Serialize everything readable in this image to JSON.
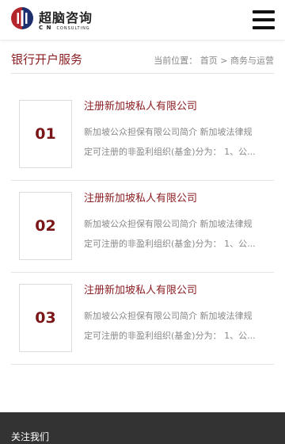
{
  "header": {
    "brand_cn": "超脑咨询",
    "brand_letters": "C N",
    "brand_en": "CONSULTING",
    "colors": {
      "red": "#b3262c",
      "navy": "#1d2f6f"
    }
  },
  "page": {
    "title": "银行开户服务",
    "breadcrumb_label": "当前位置：",
    "breadcrumb_home": "首页",
    "breadcrumb_sep": ">",
    "breadcrumb_current": "商务与运营"
  },
  "items": [
    {
      "number": "01",
      "title": "注册新加坡私人有限公司",
      "desc_line1": "新加坡公众担保有限公司简介 新加坡法律规",
      "desc_line2": "定可注册的非盈利组织(基金)分为：  1、公..."
    },
    {
      "number": "02",
      "title": "注册新加坡私人有限公司",
      "desc_line1": "新加坡公众担保有限公司简介 新加坡法律规",
      "desc_line2": "定可注册的非盈利组织(基金)分为：  1、公..."
    },
    {
      "number": "03",
      "title": "注册新加坡私人有限公司",
      "desc_line1": "新加坡公众担保有限公司简介 新加坡法律规",
      "desc_line2": "定可注册的非盈利组织(基金)分为：  1、公..."
    }
  ],
  "footer": {
    "title": "关注我们"
  }
}
